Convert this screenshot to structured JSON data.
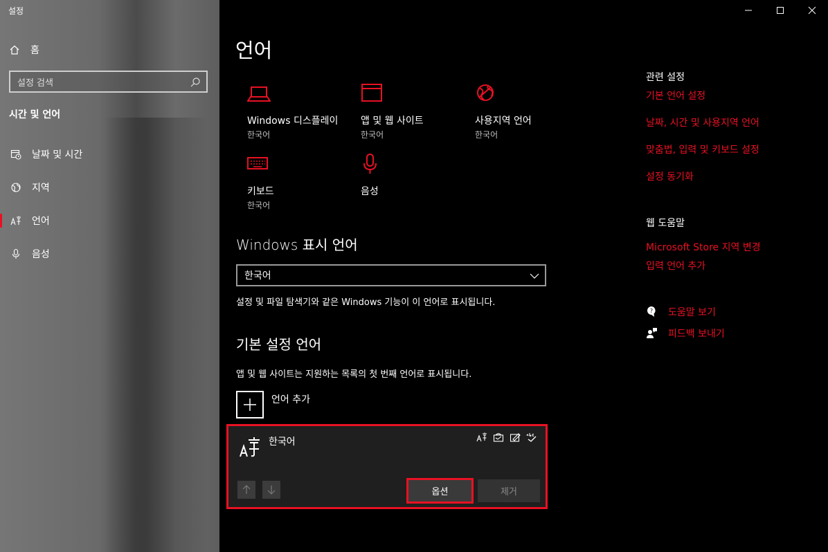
{
  "window": {
    "title": "설정"
  },
  "sidebar": {
    "home_label": "홈",
    "search_placeholder": "설정 검색",
    "section_title": "시간 및 언어",
    "items": [
      {
        "label": "날짜 및 시간",
        "icon": "calendar-clock-icon"
      },
      {
        "label": "지역",
        "icon": "globe-region-icon"
      },
      {
        "label": "언어",
        "icon": "language-icon",
        "active": true
      },
      {
        "label": "음성",
        "icon": "microphone-icon"
      }
    ]
  },
  "main": {
    "title": "언어",
    "tiles": [
      {
        "name": "Windows 디스플레이",
        "sub": "한국어",
        "icon": "laptop-icon"
      },
      {
        "name": "앱 및 웹 사이트",
        "sub": "한국어",
        "icon": "browser-window-icon"
      },
      {
        "name": "사용지역 언어",
        "sub": "한국어",
        "icon": "globe-icon"
      },
      {
        "name": "키보드",
        "sub": "한국어",
        "icon": "keyboard-icon"
      },
      {
        "name": "음성",
        "sub": "",
        "icon": "microphone-icon"
      }
    ],
    "display_language": {
      "heading": "Windows 표시 언어",
      "selected": "한국어",
      "description": "설정 및 파일 탐색기와 같은 Windows 기능이 이 언어로 표시됩니다."
    },
    "preferred": {
      "heading": "기본 설정 언어",
      "description": "앱 및 웹 사이트는 지원하는 목록의 첫 번째 언어로 표시됩니다.",
      "add_label": "언어 추가",
      "language": {
        "name": "한국어",
        "options_label": "옵션",
        "remove_label": "제거"
      }
    }
  },
  "right_panel": {
    "related_title": "관련 설정",
    "related_links": [
      "기본 언어 설정",
      "날짜, 시간 및 사용지역 언어",
      "맞춤법, 입력 및 키보드 설정",
      "설정 동기화"
    ],
    "web_help_title": "웹 도움말",
    "web_help_links": [
      "Microsoft Store 지역 변경",
      "입력 언어 추가"
    ],
    "help_label": "도움말 보기",
    "feedback_label": "피드백 보내기"
  },
  "colors": {
    "accent": "#e81123",
    "background": "#000000",
    "sidebar": "#6b6b6b"
  }
}
